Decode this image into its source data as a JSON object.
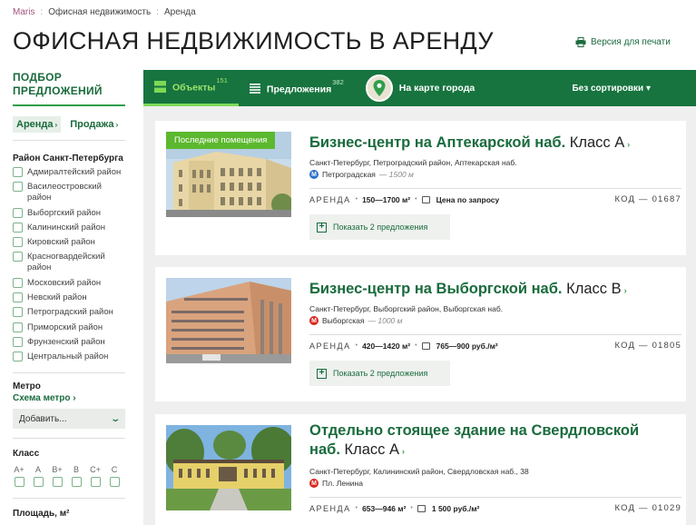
{
  "breadcrumbs": {
    "home": "Maris",
    "sep1": ":",
    "section": "Офисная недвижимость",
    "sep2": ":",
    "current": "Аренда"
  },
  "page_title": "ОФИСНАЯ НЕДВИЖИМОСТЬ В АРЕНДУ",
  "print_link": "Версия для печати",
  "sidebar": {
    "title_line1": "ПОДБОР",
    "title_line2": "ПРЕДЛОЖЕНИЙ",
    "deal_tabs": [
      {
        "label": "Аренда",
        "arrow": "›",
        "active": true
      },
      {
        "label": "Продажа",
        "arrow": "›",
        "active": false
      }
    ],
    "district_title": "Район Санкт-Петербурга",
    "districts": [
      "Адмиралтейский район",
      "Василеостровский район",
      "Выборгский район",
      "Калининский район",
      "Кировский район",
      "Красногвардейский район",
      "Московский район",
      "Невский район",
      "Петроградский район",
      "Приморский район",
      "Фрунзенский район",
      "Центральный район"
    ],
    "metro_title": "Метро",
    "metro_link": "Схема метро ›",
    "metro_select": "Добавить...",
    "class_title": "Класс",
    "classes": [
      "A+",
      "A",
      "B+",
      "B",
      "C+",
      "C"
    ],
    "area_title": "Площадь, м²"
  },
  "toolbar": {
    "objects_label": "Объекты",
    "objects_count": "151",
    "offers_label": "Предложения",
    "offers_count": "382",
    "map_label": "На карте города",
    "sort_label": "Без сортировки ▾"
  },
  "listings": [
    {
      "badge": "Последние помещения",
      "name": "Бизнес-центр на Аптекарской наб.",
      "class": "Класс A",
      "arrow": "›",
      "address": "Санкт-Петербург, Петроградский район, Аптекарская наб.",
      "metro_station": "Петроградская",
      "metro_distance": "— 1500 м",
      "metro_icon": "М",
      "metro_color": "#2a6fc9",
      "operation": "АРЕНДА",
      "area": "150—1700 м²",
      "price": "Цена по запросу",
      "code": "КОД — 01687",
      "show_offers": "Показать 2 предложения"
    },
    {
      "badge": "",
      "name": "Бизнес-центр на Выборгской наб.",
      "class": "Класс B",
      "arrow": "›",
      "address": "Санкт-Петербург, Выборгский район, Выборгская наб.",
      "metro_station": "Выборгская",
      "metro_distance": "— 1000 м",
      "metro_icon": "М",
      "metro_color": "#d8261e",
      "operation": "АРЕНДА",
      "area": "420—1420 м²",
      "price": "765—900 руб./м²",
      "code": "КОД — 01805",
      "show_offers": "Показать 2 предложения"
    },
    {
      "badge": "",
      "name": "Отдельно стоящее здание на Свердловской наб.",
      "class": "Класс A",
      "arrow": "›",
      "address": "Санкт-Петербург, Калининский район, Свердловская наб., 38",
      "metro_station": "Пл. Ленина",
      "metro_distance": "",
      "metro_icon": "М",
      "metro_color": "#d8261e",
      "operation": "АРЕНДА",
      "area": "653—946 м²",
      "price": "1 500 руб./м²",
      "code": "КОД — 01029",
      "show_offers": ""
    }
  ],
  "colors": {
    "brand_green": "#17743f",
    "accent_green": "#7ed957",
    "link_green": "#1a6b3d",
    "badge_green": "#5cb82e",
    "brand_purple": "#a1527d"
  },
  "icons": {
    "print": "printer-icon",
    "objects": "grid-icon",
    "offers": "list-icon",
    "map": "map-pin-icon",
    "metro": "metro-icon",
    "expand": "plus-icon"
  }
}
